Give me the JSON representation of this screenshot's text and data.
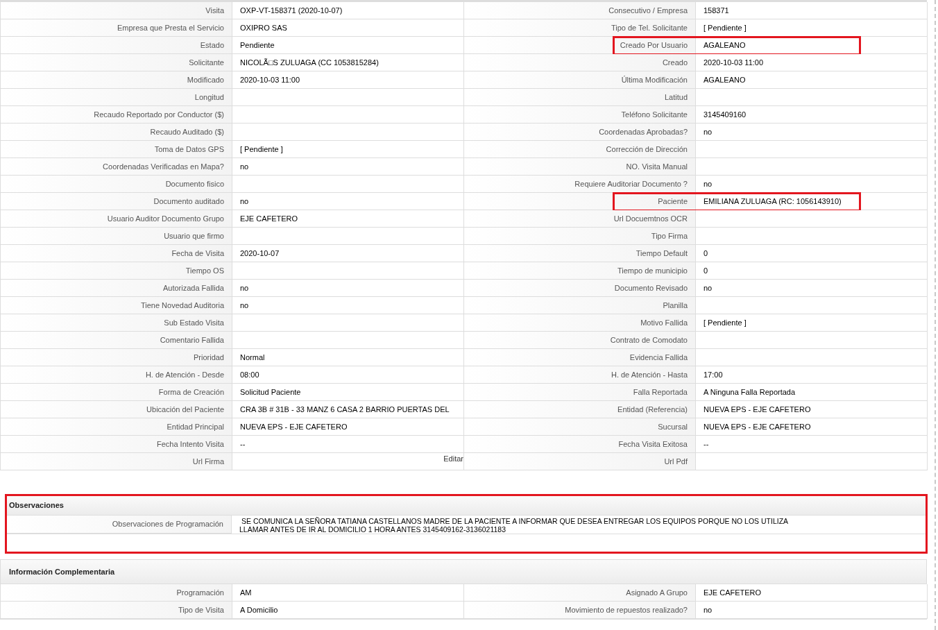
{
  "details": {
    "rows": [
      [
        {
          "label": "Visita",
          "value": "OXP-VT-158371 (2020-10-07)"
        },
        {
          "label": "Consecutivo / Empresa",
          "value": "158371"
        }
      ],
      [
        {
          "label": "Empresa que Presta el Servicio",
          "value": "OXIPRO SAS"
        },
        {
          "label": "Tipo de Tel. Solicitante",
          "value": "[ Pendiente ]"
        }
      ],
      [
        {
          "label": "Estado",
          "value": "Pendiente"
        },
        {
          "label": "Creado Por Usuario",
          "value": "AGALEANO",
          "highlighted": true
        }
      ],
      [
        {
          "label": "Solicitante",
          "value": "NICOLÃ□S ZULUAGA (CC 1053815284)"
        },
        {
          "label": "Creado",
          "value": "2020-10-03 11:00"
        }
      ],
      [
        {
          "label": "Modificado",
          "value": "2020-10-03 11:00"
        },
        {
          "label": "Última Modificación",
          "value": "AGALEANO"
        }
      ],
      [
        {
          "label": "Longitud"
        },
        {
          "label": "Latitud"
        }
      ],
      [
        {
          "label": "Recaudo Reportado por Conductor ($)"
        },
        {
          "label": "Teléfono Solicitante",
          "value": "3145409160"
        }
      ],
      [
        {
          "label": "Recaudo Auditado ($)"
        },
        {
          "label": "Coordenadas Aprobadas?",
          "value": "no"
        }
      ],
      [
        {
          "label": "Toma de Datos GPS",
          "value": "[ Pendiente ]"
        },
        {
          "label": "Corrección de Dirección"
        }
      ],
      [
        {
          "label": "Coordenadas Verificadas en Mapa?",
          "value": "no"
        },
        {
          "label": "NO. Visita Manual"
        }
      ],
      [
        {
          "label": "Documento fisico"
        },
        {
          "label": "Requiere Auditoriar Documento ?",
          "value": "no"
        }
      ],
      [
        {
          "label": "Documento auditado",
          "value": "no"
        },
        {
          "label": "Paciente",
          "value": "EMILIANA ZULUAGA (RC: 1056143910)",
          "highlighted": true
        }
      ],
      [
        {
          "label": "Usuario Auditor Documento Grupo",
          "value": "EJE CAFETERO"
        },
        {
          "label": "Url Docuemtnos OCR"
        }
      ],
      [
        {
          "label": "Usuario que firmo"
        },
        {
          "label": "Tipo Firma"
        }
      ],
      [
        {
          "label": "Fecha de Visita",
          "value": "2020-10-07"
        },
        {
          "label": "Tiempo Default",
          "value": "0"
        }
      ],
      [
        {
          "label": "Tiempo OS"
        },
        {
          "label": "Tiempo de municipio",
          "value": "0"
        }
      ],
      [
        {
          "label": "Autorizada Fallida",
          "value": "no"
        },
        {
          "label": "Documento Revisado",
          "value": "no"
        }
      ],
      [
        {
          "label": "Tiene Novedad Auditoria",
          "value": "no"
        },
        {
          "label": "Planilla"
        }
      ],
      [
        {
          "label": "Sub Estado Visita"
        },
        {
          "label": "Motivo Fallida",
          "value": "[ Pendiente ]"
        }
      ],
      [
        {
          "label": "Comentario Fallida"
        },
        {
          "label": "Contrato de Comodato"
        }
      ],
      [
        {
          "label": "Prioridad",
          "value": "Normal"
        },
        {
          "label": "Evidencia Fallida"
        }
      ],
      [
        {
          "label": "H. de Atención - Desde",
          "value": "08:00"
        },
        {
          "label": "H. de Atención - Hasta",
          "value": "17:00"
        }
      ],
      [
        {
          "label": "Forma de Creación",
          "value": "Solicitud Paciente"
        },
        {
          "label": "Falla Reportada",
          "value": "A Ninguna Falla Reportada"
        }
      ],
      [
        {
          "label": "Ubicación del Paciente",
          "value": "CRA 3B # 31B - 33 MANZ 6 CASA 2 BARRIO PUERTAS DEL"
        },
        {
          "label": "Entidad (Referencia)",
          "value": "NUEVA EPS - EJE CAFETERO"
        }
      ],
      [
        {
          "label": "Entidad Principal",
          "value": "NUEVA EPS - EJE CAFETERO"
        },
        {
          "label": "Sucursal",
          "value": "NUEVA EPS - EJE CAFETERO"
        }
      ],
      [
        {
          "label": "Fecha Intento Visita",
          "value": "--"
        },
        {
          "label": "Fecha Visita Exitosa",
          "value": "--"
        }
      ],
      [
        {
          "label": "Url Firma",
          "link": "Editar"
        },
        {
          "label": "Url Pdf"
        }
      ]
    ]
  },
  "observaciones": {
    "title": "Observaciones",
    "highlighted": true,
    "label": "Observaciones de Programación",
    "lines": [
      "SE COMUNICA LA SEÑORA TATIANA CASTELLANOS MADRE DE LA PACIENTE A INFORMAR QUE DESEA ENTREGAR LOS EQUIPOS PORQUE NO LOS UTILIZA",
      "LLAMAR ANTES DE IR AL DOMICILIO 1 HORA ANTES 3145409162-3136021183"
    ]
  },
  "complementaria": {
    "title": "Información Complementaria",
    "rows": [
      [
        {
          "label": "Programación",
          "value": "AM"
        },
        {
          "label": "Asignado A Grupo",
          "value": "EJE CAFETERO"
        }
      ],
      [
        {
          "label": "Tipo de Visita",
          "value": "A Domicilio"
        },
        {
          "label": "Movimiento de repuestos realizado?",
          "value": "no"
        }
      ]
    ]
  }
}
